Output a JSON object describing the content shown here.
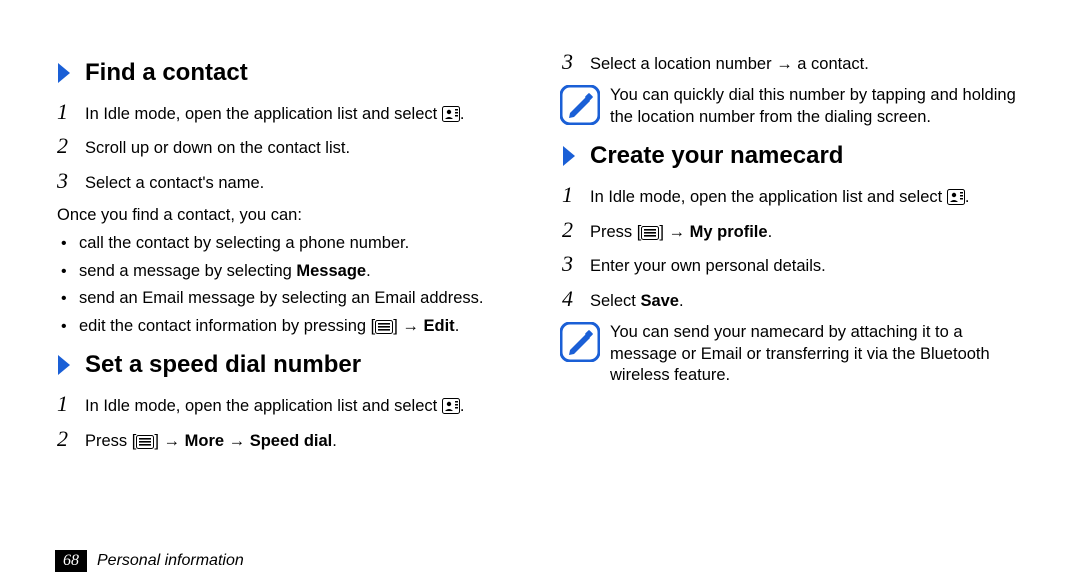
{
  "left": {
    "h1": "Find a contact",
    "s1": "In Idle mode, open the application list and select ",
    "s2": "Scroll up or down on the contact list.",
    "s3": "Select a contact's name.",
    "para": "Once you find a contact, you can:",
    "b1": "call the contact by selecting a phone number.",
    "b2a": "send a message by selecting ",
    "b2b": "Message",
    "b2c": ".",
    "b3": "send an Email message by selecting an Email address.",
    "b4a": "edit the contact information by pressing [",
    "b4b": "] → ",
    "b4c": "Edit",
    "b4d": ".",
    "h2": "Set a speed dial number",
    "s4": "In Idle mode, open the application list and select ",
    "s5a": "Press [",
    "s5b": "] → ",
    "s5c": "More",
    "s5d": " → ",
    "s5e": "Speed dial",
    "s5f": "."
  },
  "right": {
    "s1": "Select a location number → a contact.",
    "note1": "You can quickly dial this number by tapping and holding the location number from the dialing screen.",
    "h1": "Create your namecard",
    "s2": "In Idle mode, open the application list and select ",
    "s3a": "Press [",
    "s3b": "] → ",
    "s3c": "My profile",
    "s3d": ".",
    "s4": "Enter your own personal details.",
    "s5a": "Select ",
    "s5b": "Save",
    "s5c": ".",
    "note2": "You can send your namecard by attaching it to a message or Email or transferring it via the Bluetooth wireless feature."
  },
  "nums": {
    "n1": "1",
    "n2": "2",
    "n3": "3",
    "n4": "4"
  },
  "footer": {
    "page": "68",
    "section": "Personal information"
  }
}
